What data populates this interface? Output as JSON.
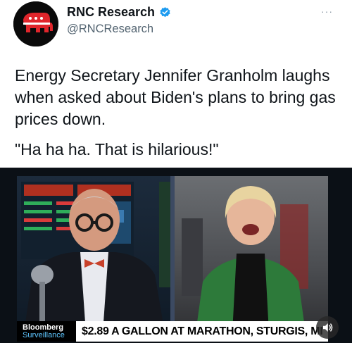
{
  "account": {
    "display_name": "RNC Research",
    "handle": "@RNCResearch",
    "verified_icon": "verified-badge-icon",
    "avatar_icon": "gop-elephant-icon",
    "more_icon": "more-options-icon",
    "more_label": "···"
  },
  "tweet": {
    "text_line1": "Energy Secretary Jennifer Granholm laughs when asked about Biden's plans to bring gas prices down.",
    "quote": "\"Ha ha ha. That is hilarious!\""
  },
  "video": {
    "network_top": "Bloomberg",
    "network_bottom": "Surveillance",
    "headline": "$2.89 A GALLON AT MARATHON, STURGIS, MI",
    "sound_icon": "speaker-icon"
  },
  "colors": {
    "brand_accent": "#1d9bf0",
    "avatar_bg": "#0a0a0a",
    "elephant_red": "#e0252b",
    "bloomberg_blue": "#5ec6ff"
  }
}
